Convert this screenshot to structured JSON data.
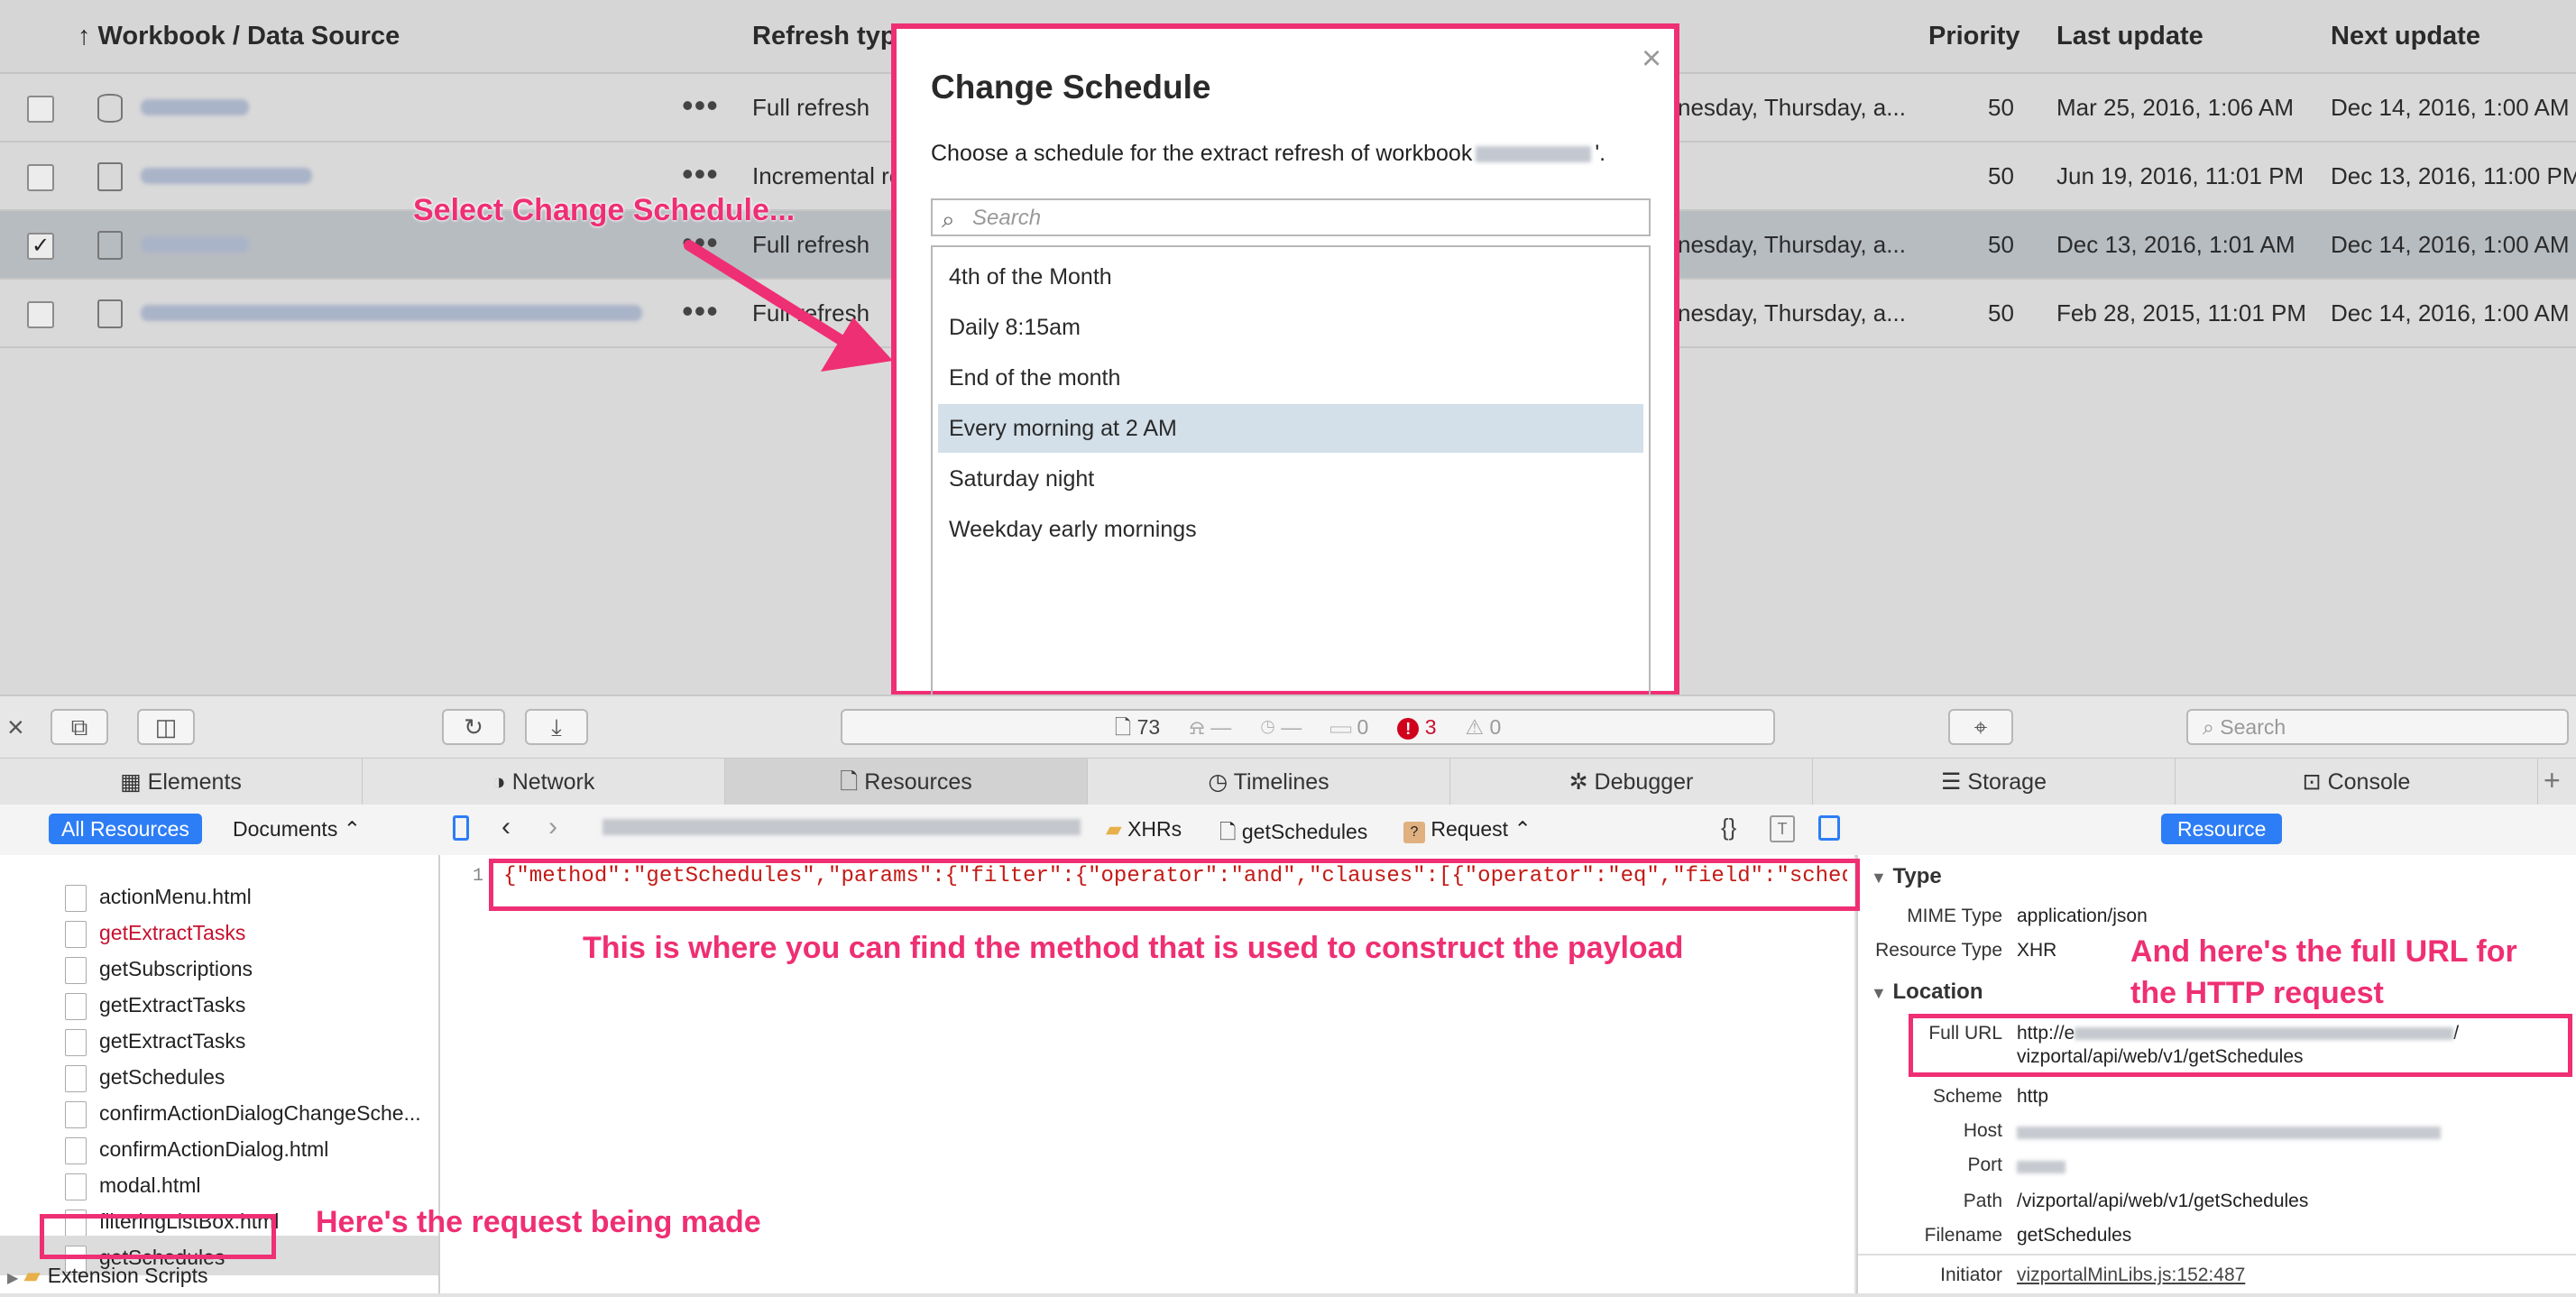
{
  "table": {
    "headers": {
      "workbook": "↑ Workbook / Data Source",
      "refresh_type": "Refresh type",
      "priority": "Priority",
      "last_update": "Last update",
      "next_update": "Next update"
    },
    "rows": [
      {
        "checked": "",
        "refresh": "Full refresh",
        "schedule": "nesday, Thursday, a...",
        "priority": "50",
        "last": "Mar 25, 2016, 1:06 AM",
        "next": "Dec 14, 2016, 1:00 AM"
      },
      {
        "checked": "",
        "refresh": "Incremental re",
        "schedule": "",
        "priority": "50",
        "last": "Jun 19, 2016, 11:01 PM",
        "next": "Dec 13, 2016, 11:00 PM"
      },
      {
        "checked": "✓",
        "refresh": "Full refresh",
        "schedule": "nesday, Thursday, a...",
        "priority": "50",
        "last": "Dec 13, 2016, 1:01 AM",
        "next": "Dec 14, 2016, 1:00 AM"
      },
      {
        "checked": "",
        "refresh": "Full refresh",
        "schedule": "nesday, Thursday, a...",
        "priority": "50",
        "last": "Feb 28, 2015, 11:01 PM",
        "next": "Dec 14, 2016, 1:00 AM"
      }
    ]
  },
  "modal": {
    "title": "Change Schedule",
    "close": "×",
    "desc_prefix": "Choose a schedule for the extract refresh of workbook",
    "desc_suffix": "'.",
    "search_placeholder": "Search",
    "schedules": [
      "4th of the Month",
      "Daily 8:15am",
      "End of the month",
      "Every morning at 2 AM",
      "Saturday night",
      "Weekday early mornings"
    ]
  },
  "annotations": {
    "select_change": "Select Change Schedule...",
    "method_note": "This is where you can find the method that is used to construct the payload",
    "url_note_1": "And here's the full URL for",
    "url_note_2": "the HTTP request",
    "request_note": "Here's the request being made"
  },
  "devtools": {
    "toolbar": {
      "resources_count": "73",
      "dash1": "—",
      "dash2": "—",
      "logs": "0",
      "errors": "3",
      "warnings": "0",
      "search_placeholder": "Search"
    },
    "tabs": [
      "Elements",
      "Network",
      "Resources",
      "Timelines",
      "Debugger",
      "Storage",
      "Console"
    ],
    "subbar": {
      "all_resources": "All Resources",
      "documents": "Documents ⌃",
      "xhrs": "XHRs",
      "get_schedules": "getSchedules",
      "request": "Request ⌃",
      "resource": "Resource"
    },
    "sidebar_items": [
      "actionMenu.html",
      "getExtractTasks",
      "getSubscriptions",
      "getExtractTasks",
      "getExtractTasks",
      "getSchedules",
      "confirmActionDialogChangeSche...",
      "confirmActionDialog.html",
      "modal.html",
      "filteringListBox.html",
      "getSchedules"
    ],
    "extension_scripts": "Extension Scripts",
    "line_number": "1",
    "code": "{\"method\":\"getSchedules\",\"params\":{\"filter\":{\"operator\":\"and\",\"clauses\":[{\"operator\":\"eq\",\"field\":\"scheduledActio",
    "details": {
      "type_heading": "Type",
      "mime_label": "MIME Type",
      "mime_value": "application/json",
      "rtype_label": "Resource Type",
      "rtype_value": "XHR",
      "location_heading": "Location",
      "full_url_label": "Full URL",
      "full_url_1": "http://e",
      "full_url_2": "vizportal/api/web/v1/getSchedules",
      "scheme_label": "Scheme",
      "scheme_value": "http",
      "host_label": "Host",
      "port_label": "Port",
      "path_label": "Path",
      "path_value": "/vizportal/api/web/v1/getSchedules",
      "filename_label": "Filename",
      "filename_value": "getSchedules",
      "initiator_label": "Initiator",
      "initiator_value": "vizportalMinLibs.js:152:487"
    }
  }
}
